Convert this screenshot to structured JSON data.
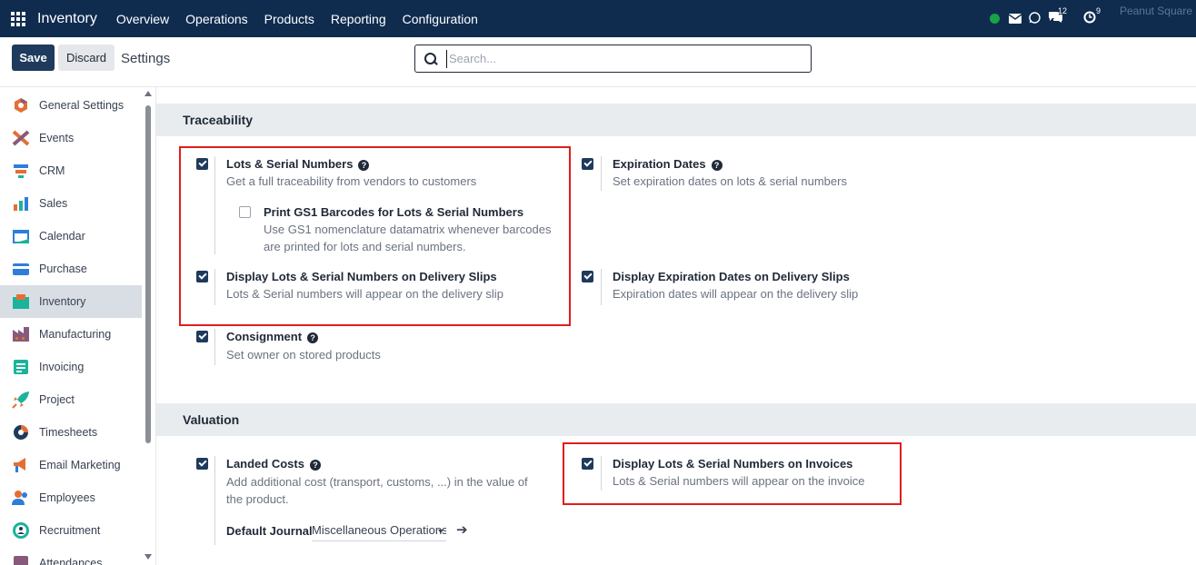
{
  "navbar": {
    "brand": "Inventory",
    "menu": [
      "Overview",
      "Operations",
      "Products",
      "Reporting",
      "Configuration"
    ],
    "messages_count": "12",
    "activities_count": "9",
    "company": "Peanut Square"
  },
  "control": {
    "save_label": "Save",
    "discard_label": "Discard",
    "breadcrumb": "Settings",
    "search_placeholder": "Search..."
  },
  "sidebar": {
    "items": [
      {
        "label": "General Settings",
        "icon": "general-settings-icon",
        "color": "#e46f35"
      },
      {
        "label": "Events",
        "icon": "events-icon",
        "color": "#e46f35"
      },
      {
        "label": "CRM",
        "icon": "crm-icon",
        "color": "#2e7ddc"
      },
      {
        "label": "Sales",
        "icon": "sales-icon",
        "color": "#e46f35"
      },
      {
        "label": "Calendar",
        "icon": "calendar-icon",
        "color": "#2e7ddc"
      },
      {
        "label": "Purchase",
        "icon": "purchase-icon",
        "color": "#2e7ddc"
      },
      {
        "label": "Inventory",
        "icon": "inventory-icon",
        "color": "#1bb39b",
        "active": true
      },
      {
        "label": "Manufacturing",
        "icon": "manufacturing-icon",
        "color": "#875a7b"
      },
      {
        "label": "Invoicing",
        "icon": "invoicing-icon",
        "color": "#1bb39b"
      },
      {
        "label": "Project",
        "icon": "project-icon",
        "color": "#1bb39b"
      },
      {
        "label": "Timesheets",
        "icon": "timesheets-icon",
        "color": "#1e3a5c"
      },
      {
        "label": "Email Marketing",
        "icon": "email-marketing-icon",
        "color": "#e46f35"
      },
      {
        "label": "Employees",
        "icon": "employees-icon",
        "color": "#2e7ddc"
      },
      {
        "label": "Recruitment",
        "icon": "recruitment-icon",
        "color": "#1bb39b"
      },
      {
        "label": "Attendances",
        "icon": "attendances-icon",
        "color": "#875a7b"
      }
    ]
  },
  "traceability": {
    "header": "Traceability",
    "lots_serial": {
      "title": "Lots & Serial Numbers",
      "desc": "Get a full traceability from vendors to customers",
      "checked": true
    },
    "gs1": {
      "title": "Print GS1 Barcodes for Lots & Serial Numbers",
      "desc": "Use GS1 nomenclature datamatrix whenever barcodes are printed for lots and serial numbers.",
      "checked": false
    },
    "display_lots_delivery": {
      "title": "Display Lots & Serial Numbers on Delivery Slips",
      "desc": "Lots & Serial numbers will appear on the delivery slip",
      "checked": true
    },
    "expiration_dates": {
      "title": "Expiration Dates",
      "desc": "Set expiration dates on lots & serial numbers",
      "checked": true
    },
    "display_expiration_delivery": {
      "title": "Display Expiration Dates on Delivery Slips",
      "desc": "Expiration dates will appear on the delivery slip",
      "checked": true
    },
    "consignment": {
      "title": "Consignment",
      "desc": "Set owner on stored products",
      "checked": true
    }
  },
  "valuation": {
    "header": "Valuation",
    "landed_costs": {
      "title": "Landed Costs",
      "desc": "Add additional cost (transport, customs, ...) in the value of the product.",
      "checked": true,
      "journal_label": "Default Journal",
      "journal_value": "Miscellaneous Operations"
    },
    "display_lots_invoices": {
      "title": "Display Lots & Serial Numbers on Invoices",
      "desc": "Lots & Serial numbers will appear on the invoice",
      "checked": true
    }
  },
  "colors": {
    "navbar": "#0f2c4f",
    "primary": "#1e3a5c",
    "highlight_box": "#e11d1d"
  }
}
